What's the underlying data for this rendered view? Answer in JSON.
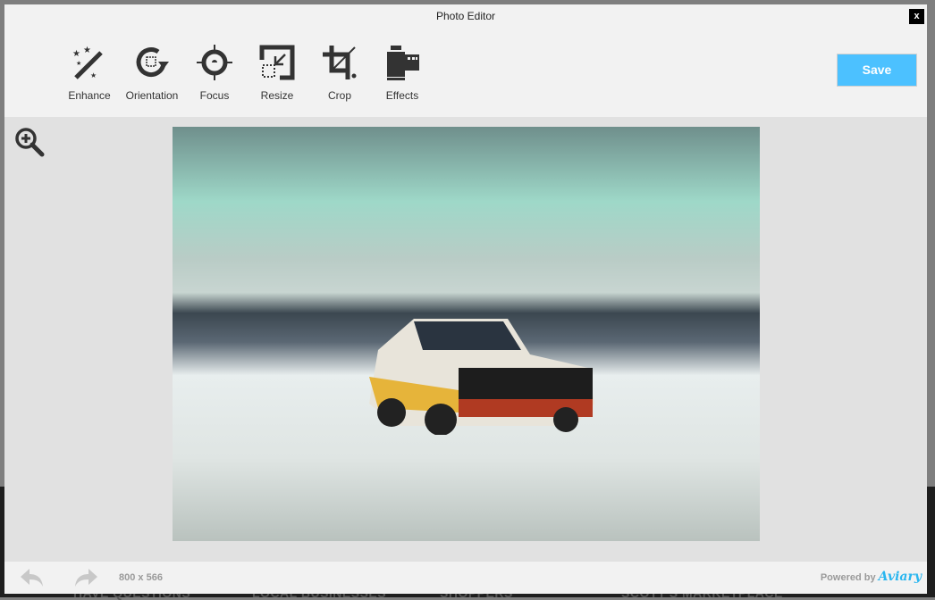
{
  "background_page": {
    "nav": [
      "HAVE QUESTIONS",
      "LOCAL BUSINESSES",
      "SHOPPERS",
      "SCOTT'S MARKETPLACE"
    ]
  },
  "window": {
    "title": "Photo Editor",
    "close_label": "x"
  },
  "toolbar": {
    "tools": [
      {
        "label": "Enhance",
        "icon": "magic-wand-icon"
      },
      {
        "label": "Orientation",
        "icon": "rotate-icon"
      },
      {
        "label": "Focus",
        "icon": "crosshair-icon"
      },
      {
        "label": "Resize",
        "icon": "resize-icon"
      },
      {
        "label": "Crop",
        "icon": "crop-icon"
      },
      {
        "label": "Effects",
        "icon": "film-icon"
      }
    ],
    "save_label": "Save"
  },
  "canvas": {
    "zoom_icon": "zoom-in-icon"
  },
  "footer": {
    "dimensions": "800 x 566",
    "powered_by": "Powered by",
    "brand": "Aviary"
  },
  "colors": {
    "accent": "#4cc1ff",
    "brand": "#2ab6ef"
  }
}
